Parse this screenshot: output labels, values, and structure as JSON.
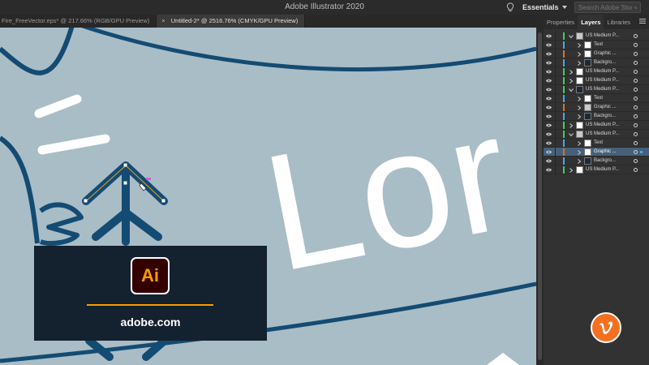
{
  "app": {
    "title": "Adobe Illustrator 2020",
    "workspace": "Essentials",
    "search_placeholder": "Search Adobe Stock"
  },
  "doc_tabs": [
    {
      "label": "Fire_FreeVector.eps* @ 217.66% (RGB/GPU Preview)",
      "active": false
    },
    {
      "label": "Untitled-2* @ 2516.76% (CMYK/GPU Preview)",
      "active": true
    }
  ],
  "panel": {
    "tabs": [
      "Properties",
      "Layers",
      "Libraries"
    ],
    "active_tab": "Layers",
    "layers": [
      {
        "name": "US Medium P...",
        "depth": 0,
        "expanded": true,
        "color": "#39d353",
        "thumb": "pattern"
      },
      {
        "name": "Text",
        "depth": 1,
        "expanded": false,
        "color": "#3fa9f5",
        "thumb": "white"
      },
      {
        "name": "Graphic ...",
        "depth": 1,
        "expanded": false,
        "color": "#e0731c",
        "thumb": "white"
      },
      {
        "name": "Backgro...",
        "depth": 1,
        "expanded": false,
        "color": "#3fa9f5",
        "thumb": "dark"
      },
      {
        "name": "US Medium P...",
        "depth": 0,
        "expanded": false,
        "color": "#39d353",
        "thumb": "white"
      },
      {
        "name": "US Medium P...",
        "depth": 0,
        "expanded": false,
        "color": "#39d353",
        "thumb": "white"
      },
      {
        "name": "US Medium P...",
        "depth": 0,
        "expanded": true,
        "color": "#39d353",
        "thumb": "dark"
      },
      {
        "name": "Text",
        "depth": 1,
        "expanded": false,
        "color": "#3fa9f5",
        "thumb": "white"
      },
      {
        "name": "Graphic ...",
        "depth": 1,
        "expanded": false,
        "color": "#e0731c",
        "thumb": "pattern"
      },
      {
        "name": "Backgro...",
        "depth": 1,
        "expanded": false,
        "color": "#3fa9f5",
        "thumb": "dark"
      },
      {
        "name": "US Medium P...",
        "depth": 0,
        "expanded": false,
        "color": "#39d353",
        "thumb": "white"
      },
      {
        "name": "US Medium P...",
        "depth": 0,
        "expanded": true,
        "color": "#39d353",
        "thumb": "pattern"
      },
      {
        "name": "Text",
        "depth": 1,
        "expanded": false,
        "color": "#3fa9f5",
        "thumb": "white"
      },
      {
        "name": "Graphic ...",
        "depth": 1,
        "expanded": false,
        "color": "#e0731c",
        "thumb": "white",
        "selected": true
      },
      {
        "name": "Backgro...",
        "depth": 1,
        "expanded": false,
        "color": "#3fa9f5",
        "thumb": "dark"
      },
      {
        "name": "US Medium P...",
        "depth": 0,
        "expanded": false,
        "color": "#39d353",
        "thumb": "white"
      }
    ]
  },
  "canvas": {
    "background": "#a9bdc7",
    "artwork_text": "Lor",
    "stroke_color": "#144b73"
  },
  "overlay": {
    "logo_text": "Ai",
    "url": "adobe.com",
    "accent": "#ff9a00"
  },
  "watermark": {
    "icon": "vimeo-icon",
    "color": "#f37021"
  }
}
